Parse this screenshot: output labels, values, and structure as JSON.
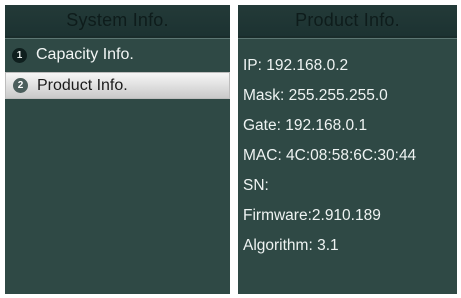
{
  "left_panel": {
    "title": "System Info.",
    "items": [
      {
        "number": "1",
        "label": "Capacity Info.",
        "selected": false
      },
      {
        "number": "2",
        "label": "Product Info.",
        "selected": true
      }
    ]
  },
  "right_panel": {
    "title": "Product Info.",
    "rows": [
      "IP: 192.168.0.2",
      "Mask: 255.255.255.0",
      "Gate: 192.168.0.1",
      "MAC: 4C:08:58:6C:30:44",
      "SN:",
      "Firmware:2.910.189",
      "Algorithm: 3.1"
    ]
  },
  "colors": {
    "panel_bg": "#2f4945",
    "header_bg": "#1c3231",
    "header_text": "#0e1c1b",
    "selection_bg": "#e6e6e6"
  }
}
